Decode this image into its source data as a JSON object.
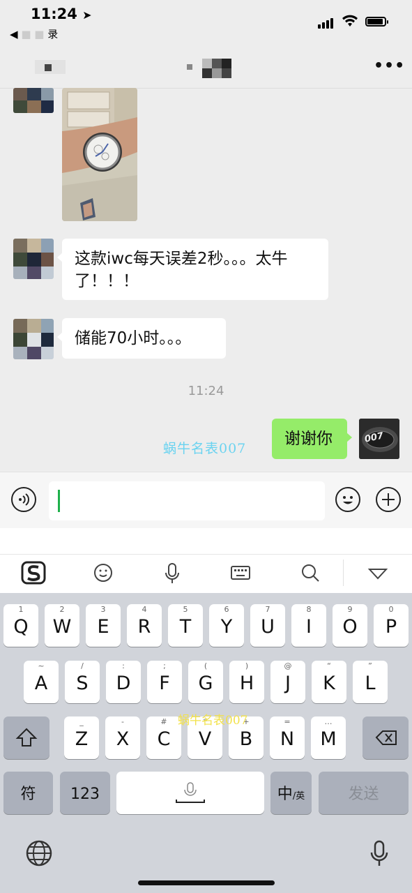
{
  "status_bar": {
    "time": "11:24",
    "back_label": "录"
  },
  "chat": {
    "messages": [
      {
        "type": "image",
        "from": "other"
      },
      {
        "type": "text",
        "from": "other",
        "text": "这款iwc每天误差2秒。。。太牛了！！！"
      },
      {
        "type": "text",
        "from": "other",
        "text": "储能70小时。。。"
      },
      {
        "type": "timestamp",
        "text": "11:24"
      },
      {
        "type": "text",
        "from": "me",
        "text": "谢谢你"
      }
    ],
    "watermark": "蜗牛名表007",
    "my_avatar_text": "007"
  },
  "keyboard": {
    "row1": [
      {
        "k": "Q",
        "s": "1"
      },
      {
        "k": "W",
        "s": "2"
      },
      {
        "k": "E",
        "s": "3"
      },
      {
        "k": "R",
        "s": "4"
      },
      {
        "k": "T",
        "s": "5"
      },
      {
        "k": "Y",
        "s": "6"
      },
      {
        "k": "U",
        "s": "7"
      },
      {
        "k": "I",
        "s": "8"
      },
      {
        "k": "O",
        "s": "9"
      },
      {
        "k": "P",
        "s": "0"
      }
    ],
    "row2": [
      {
        "k": "A",
        "s": "~"
      },
      {
        "k": "S",
        "s": "/"
      },
      {
        "k": "D",
        "s": ":"
      },
      {
        "k": "F",
        "s": ";"
      },
      {
        "k": "G",
        "s": "("
      },
      {
        "k": "H",
        "s": ")"
      },
      {
        "k": "J",
        "s": "@"
      },
      {
        "k": "K",
        "s": "“"
      },
      {
        "k": "L",
        "s": "”"
      }
    ],
    "row3": [
      {
        "k": "Z",
        "s": "_"
      },
      {
        "k": "X",
        "s": "-"
      },
      {
        "k": "C",
        "s": "#"
      },
      {
        "k": "V",
        "s": "*"
      },
      {
        "k": "B",
        "s": "+"
      },
      {
        "k": "N",
        "s": "="
      },
      {
        "k": "M",
        "s": "…"
      }
    ],
    "symbols_key": "符",
    "numbers_key": "123",
    "lang_key_main": "中",
    "lang_key_sub": "/英",
    "send_key": "发送",
    "watermark": "蜗牛名表007"
  }
}
